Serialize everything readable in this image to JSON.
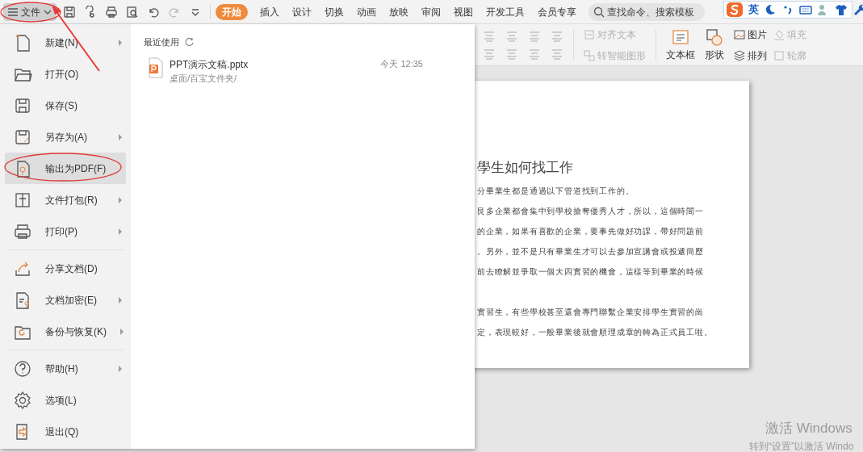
{
  "file_button": {
    "label": "文件"
  },
  "tabs": [
    {
      "label": "开始",
      "selected": true
    },
    {
      "label": "插入",
      "selected": false
    },
    {
      "label": "设计",
      "selected": false
    },
    {
      "label": "切换",
      "selected": false
    },
    {
      "label": "动画",
      "selected": false
    },
    {
      "label": "放映",
      "selected": false
    },
    {
      "label": "审阅",
      "selected": false
    },
    {
      "label": "视图",
      "selected": false
    },
    {
      "label": "开发工具",
      "selected": false
    },
    {
      "label": "会员专享",
      "selected": false
    }
  ],
  "search": {
    "placeholder": "查找命令、搜索模板"
  },
  "ime_toolbar": {
    "language": "英"
  },
  "ribbon": {
    "row_1": [
      {
        "label": "对齐文本",
        "disabled": true
      }
    ],
    "row_2": [
      {
        "label": "转智能图形",
        "disabled": true
      }
    ],
    "big_buttons": [
      {
        "label": "文本框",
        "disabled": false
      },
      {
        "label": "形状",
        "disabled": false
      }
    ],
    "small_buttons": [
      {
        "label": "图片",
        "disabled": false
      },
      {
        "label": "排列",
        "disabled": false
      },
      {
        "label": "填充",
        "disabled": true
      },
      {
        "label": "轮廓",
        "disabled": true
      }
    ]
  },
  "file_menu": {
    "items": [
      {
        "label": "新建(N)",
        "submenu": true,
        "selected": false,
        "divider_before": false
      },
      {
        "label": "打开(O)",
        "submenu": false,
        "selected": false,
        "divider_before": false
      },
      {
        "label": "保存(S)",
        "submenu": false,
        "selected": false,
        "divider_before": false
      },
      {
        "label": "另存为(A)",
        "submenu": true,
        "selected": false,
        "divider_before": false
      },
      {
        "label": "输出为PDF(F)",
        "submenu": false,
        "selected": true,
        "divider_before": false
      },
      {
        "label": "文件打包(R)",
        "submenu": true,
        "selected": false,
        "divider_before": false
      },
      {
        "label": "打印(P)",
        "submenu": true,
        "selected": false,
        "divider_before": false
      },
      {
        "label": "分享文档(D)",
        "submenu": false,
        "selected": false,
        "divider_before": true
      },
      {
        "label": "文档加密(E)",
        "submenu": true,
        "selected": false,
        "divider_before": false
      },
      {
        "label": "备份与恢复(K)",
        "submenu": true,
        "selected": false,
        "divider_before": false
      },
      {
        "label": "帮助(H)",
        "submenu": true,
        "selected": false,
        "divider_before": true
      },
      {
        "label": "选项(L)",
        "submenu": false,
        "selected": false,
        "divider_before": false
      },
      {
        "label": "退出(Q)",
        "submenu": false,
        "selected": false,
        "divider_before": false
      }
    ]
  },
  "recent": {
    "title": "最近使用",
    "files": [
      {
        "name": "PPT演示文稿.pptx",
        "path": "桌面/百宝文件夹/",
        "time": "今天 12:35"
      }
    ]
  },
  "slide": {
    "title": "學生如何找工作",
    "paragraphs": [
      [
        "分畢業生都是通過以下管道找到工作的。",
        "艮多企業都會集中到學校搶奪優秀人才，所以，這個時間一",
        "的企業，如果有喜歡的企業，要事先做好功課，帶好問題前",
        "。另外，並不是只有畢業生才可以去參加宣講會或投遞簡歷",
        "前去瞭解並爭取一個大四實習的機會，這樣等到畢業的時候"
      ],
      [
        "實習生，有些學校甚至還會專門聯繫企業安排學生實習的崗",
        "定，表現較好，一般畢業後就會順理成章的轉為正式員工啦。"
      ]
    ]
  },
  "activation": {
    "title": "激活 Windows",
    "hint": "转到“设置”以激活 Windo"
  }
}
